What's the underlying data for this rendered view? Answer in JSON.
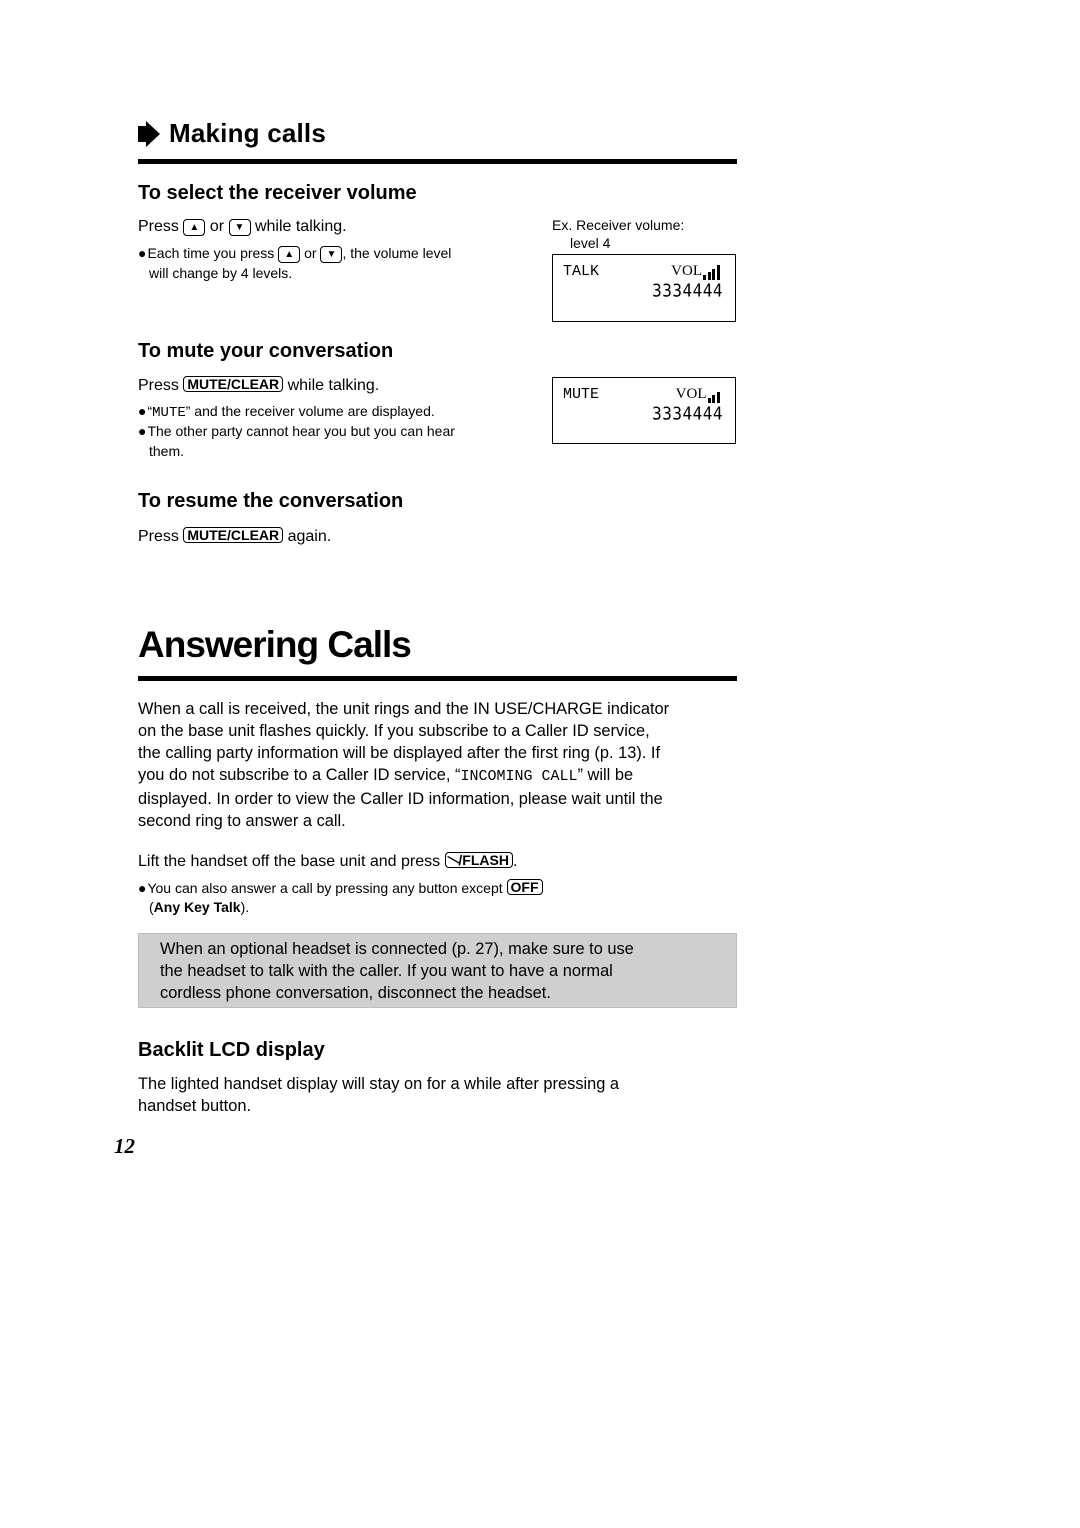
{
  "section": {
    "title": "Making calls",
    "icon": "arrow-right-icon"
  },
  "receiver_volume": {
    "heading": "To select the receiver volume",
    "press": "Press",
    "or": "or",
    "while": "while talking.",
    "up_key": "▲",
    "down_key": "▼",
    "bullet_pre": "Each time you press",
    "bullet_or": "or",
    "bullet_post": ", the volume level",
    "bullet_line2": "will change by 4 levels.",
    "example_caption_line1": "Ex. Receiver volume:",
    "example_caption_line2": "level 4",
    "lcd": {
      "mode": "TALK",
      "vol_label": "VOL",
      "volume_level": 4,
      "digits": "3334444"
    }
  },
  "mute": {
    "heading": "To mute your conversation",
    "press": "Press",
    "key": "MUTE/CLEAR",
    "post": "while talking.",
    "bullet1_quote_open": "“",
    "bullet1_mono": "MUTE",
    "bullet1_rest": "” and the receiver volume are displayed.",
    "bullet2_line1": "The other party cannot hear you but you can hear",
    "bullet2_line2": "them.",
    "lcd": {
      "mode": "MUTE",
      "vol_label": "VOL",
      "volume_level": 3,
      "digits": "3334444"
    }
  },
  "resume": {
    "heading": "To resume the conversation",
    "press": "Press",
    "key": "MUTE/CLEAR",
    "post": "again."
  },
  "answering": {
    "title": "Answering Calls",
    "para_lines": [
      "When a call is received, the unit rings and the IN USE/CHARGE indicator",
      "on the base unit flashes quickly. If you subscribe to a Caller ID service,",
      "the calling party information will be displayed after the first ring (p. 13). If"
    ],
    "para_line4_pre": "you do not subscribe to a Caller ID service, “",
    "para_line4_mono": "INCOMING CALL",
    "para_line4_post": "” will be",
    "para_lines_after": [
      "displayed. In order to view the Caller ID information, please wait until the",
      "second ring to answer a call."
    ],
    "lift_pre": "Lift the handset off the base unit and press",
    "flash_key": "/FLASH",
    "lift_post": ".",
    "bullet_pre": "You can also answer a call by pressing any button except",
    "off_key": "OFF",
    "any_key_open": "(",
    "any_key_bold": "Any Key Talk",
    "any_key_close": ")."
  },
  "note": {
    "text_lines": [
      "When an optional headset is connected (p. 27), make sure to use",
      "the headset to talk with the caller. If you want to have a normal",
      "cordless phone conversation, disconnect the headset."
    ]
  },
  "backlit": {
    "heading": "Backlit LCD display",
    "lines": [
      "The lighted handset display will stay on for a while after pressing a",
      "handset button."
    ]
  },
  "page_number": "12"
}
